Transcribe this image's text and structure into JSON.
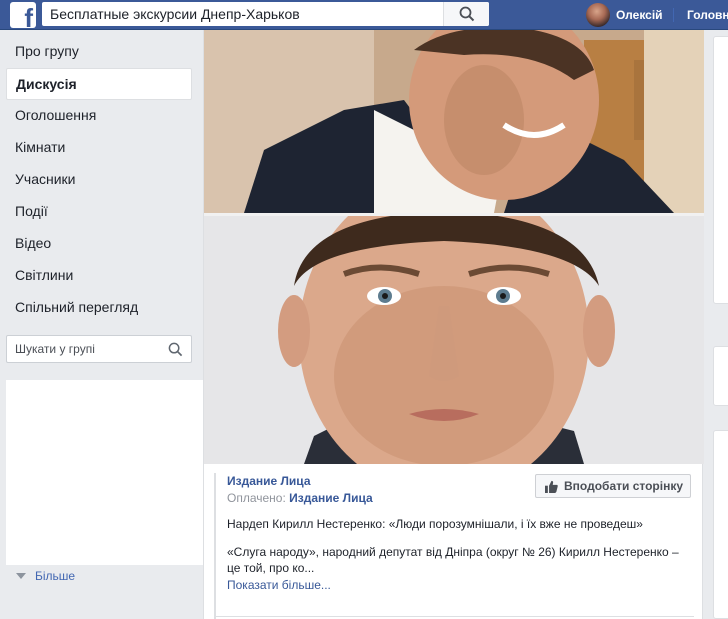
{
  "topbar": {
    "search_value": "Бесплатные экскурсии Днепр-Харьков",
    "user_name": "Олексій",
    "home_label": "Головна"
  },
  "left_nav": {
    "items": [
      {
        "label": "Про групу",
        "active": false
      },
      {
        "label": "Дискусія",
        "active": true
      },
      {
        "label": "Оголошення",
        "active": false
      },
      {
        "label": "Кімнати",
        "active": false
      },
      {
        "label": "Учасники",
        "active": false
      },
      {
        "label": "Події",
        "active": false
      },
      {
        "label": "Відео",
        "active": false
      },
      {
        "label": "Світлини",
        "active": false
      },
      {
        "label": "Спільний перегляд",
        "active": false
      }
    ],
    "group_search_placeholder": "Шукати у групі",
    "more_label": "Більше"
  },
  "ad": {
    "page_name": "Издание Лица",
    "paid_prefix": "Оплачено:",
    "paid_by": "Издание Лица",
    "like_button": "Вподобати сторінку",
    "headline": "Нардеп Кирилл Нестеренко: «Люди порозумнішали, і їх вже не проведеш»",
    "body": "«Слуга народу», народний депутат від Дніпра (округ № 26) Кирилл Нестеренко – це той, про ко...",
    "show_more": "Показати більше..."
  },
  "colors": {
    "brand": "#3b5998",
    "link": "#385898",
    "page_bg": "#e9ebee"
  }
}
